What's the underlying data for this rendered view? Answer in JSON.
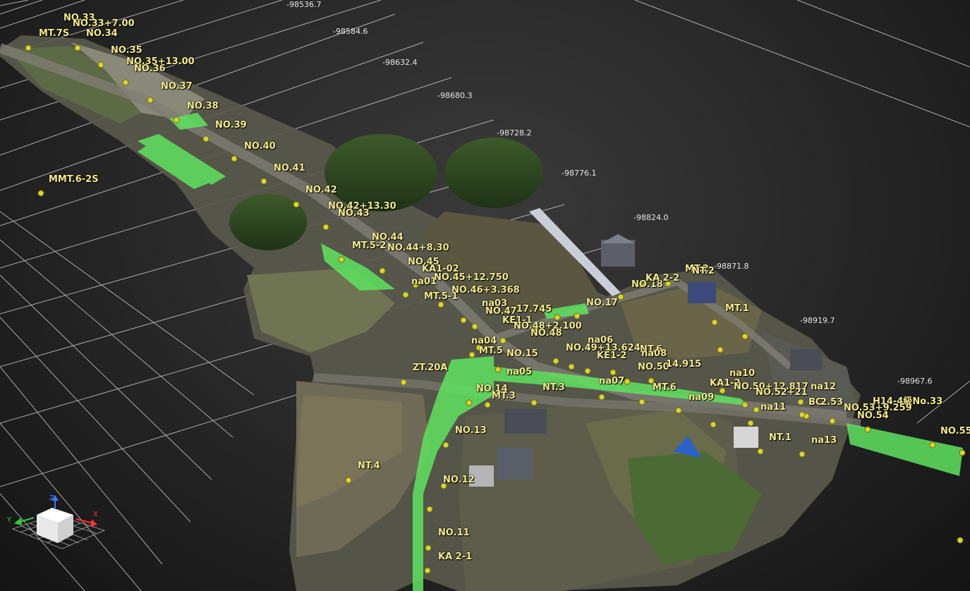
{
  "viewer": {
    "grid_color": "#d8d8d8",
    "label_color": "#f1e98c",
    "marker_color": "#d8d530",
    "alignment_color": "#5fe35f"
  },
  "grid_axis_labels": [
    "-98536.7",
    "-98584.6",
    "-98632.4",
    "-98680.3",
    "-98728.2",
    "-98776.1",
    "-98824.0",
    "-98871.8",
    "-98919.7",
    "-98967.6"
  ],
  "survey_points": [
    "NO.33",
    "NO.33+7.00",
    "MT.7S",
    "NO.34",
    "NO.35",
    "NO.35+13.00",
    "NO.36",
    "NO.37",
    "NO.38",
    "NO.39",
    "NO.40",
    "NO.41",
    "MMT.6-2S",
    "NO.42",
    "NO.42+13.30",
    "NO.43",
    "NO.44",
    "MT.5-2",
    "NO.44+8.30",
    "NO.45",
    "KA1-02",
    "na01",
    "NO.45+12.750",
    "NO.46+3.368",
    "MT.5-1",
    "na03",
    "NO.47",
    "17.745",
    "KE1-1",
    "NO.48+2.100",
    "NO.48",
    "NO.17",
    "NO.18",
    "KA 2-2",
    "MT.2",
    "NT.2",
    "MT.1",
    "na04",
    "na06",
    "NO.49+13.624",
    "MT.5",
    "KE1-2",
    "NT.6",
    "na08",
    "NO.15",
    "NO.50",
    "14.915",
    "ZT.20A",
    "na05",
    "na07",
    "na10",
    "NO.14",
    "NT.3",
    "MT.6",
    "KA1-2",
    "NO.50+12.817",
    "na12",
    "MT.3",
    "na09",
    "NO.52+21",
    "BC",
    "2.53",
    "na11",
    "H14-4級No.33",
    "NO.53+9.259",
    "NO.54",
    "NO.13",
    "NT.1",
    "na13",
    "NO.55",
    "NT.4",
    "NO.12",
    "NO.11",
    "KA 2-1"
  ],
  "axis_gizmo": {
    "x_label": "X",
    "y_label": "Y",
    "z_label": "Z"
  }
}
